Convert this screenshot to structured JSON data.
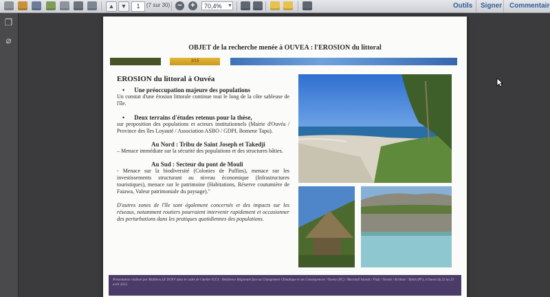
{
  "toolbar": {
    "page_current": "1",
    "page_count": "(7 sur 30)",
    "zoom_value": "70,4%",
    "links": {
      "tools": "Outils",
      "sign": "Signer",
      "comment": "Commentaire"
    }
  },
  "slide": {
    "header": "OBJET de la recherche menée à OUVEA : l'EROSION du littoral",
    "progress_label": "3/15",
    "section_title": "EROSION du littoral à Ouvéa",
    "bullet1": {
      "title": "Une préoccupation majeure des populations",
      "text": "Un constat d'une érosion littorale continue tout le long de la côte sableuse de l'île."
    },
    "bullet2": {
      "title": "Deux terrains d'études retenus pour la thèse,",
      "text": "sur proposition des populations et acteurs institutionnels (Mairie d'Ouvéa / Province des îles Loyauté / Association ASBO / GDPL Bomene Tapu)."
    },
    "nord": {
      "title": "Au Nord : Tribu de Saint Joseph et Takedji",
      "text": "– Menace immédiate sur la sécurité des populations et des structures bâties."
    },
    "sud": {
      "title": "Au Sud : Secteur du pont de Mouli",
      "text": "- Menace sur la biodiversité (Colonies de Puffins), menace sur les investissements structurant au niveau économique (Infrastructures touristiques), menace sur le patrimoine (Habitations, Réserve coutumière de Faiawa, Valeur patrimoniale du paysage).\""
    },
    "other_zones": "D'autres zones de l'île sont également concernés et des impacts sur les réseaux, notamment routiers pourraient intervenir rapidement et occasionner des perturbations dans les pratiques quotidiennes des populations.",
    "footer": "Présentation réalisée par Matthieu LE DUFF dans le cadre de l'atelier ICCS : Résilience Régionale face au Changement Climatique et ses Conséquences / Ouvéa (NC) / Marshall Islands / Fidji / Tuvalu / Kiribati / Tahiti (PF), à Ouvéa du 22 au 23 avril 2013."
  },
  "colors": {
    "bar_olive": "#4a5228",
    "bar_gold": "#d9aa2e",
    "bar_blue": "#4a80c4",
    "footer_bg": "#4b3b68"
  }
}
